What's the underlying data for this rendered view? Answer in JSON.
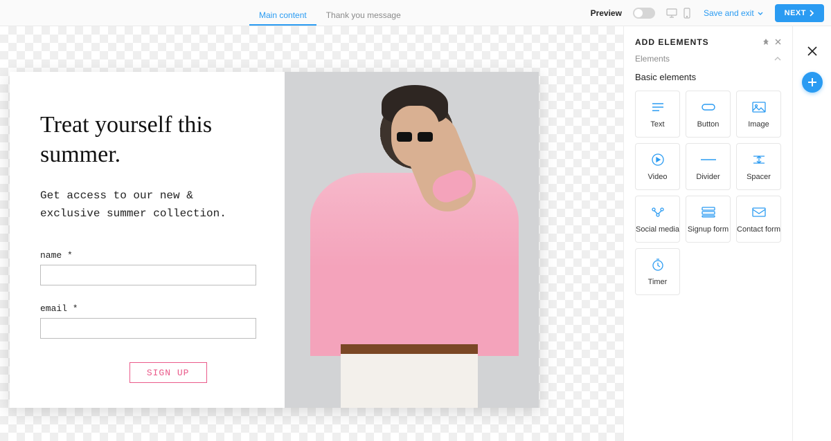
{
  "topbar": {
    "tabs": {
      "main": "Main content",
      "thank_you": "Thank you message"
    },
    "preview_label": "Preview",
    "save_label": "Save and exit",
    "next_label": "NEXT"
  },
  "popup": {
    "title": "Treat yourself this summer.",
    "subtitle": "Get access to our new & exclusive summer collection.",
    "name_label": "name *",
    "email_label": "email *",
    "signup_label": "SIGN UP"
  },
  "sidebar": {
    "panel_title": "ADD ELEMENTS",
    "section_label": "Elements",
    "group_label": "Basic elements",
    "elements": {
      "text": "Text",
      "button": "Button",
      "image": "Image",
      "video": "Video",
      "divider": "Divider",
      "spacer": "Spacer",
      "social": "Social media",
      "signup": "Signup form",
      "contact": "Contact form",
      "timer": "Timer"
    }
  }
}
